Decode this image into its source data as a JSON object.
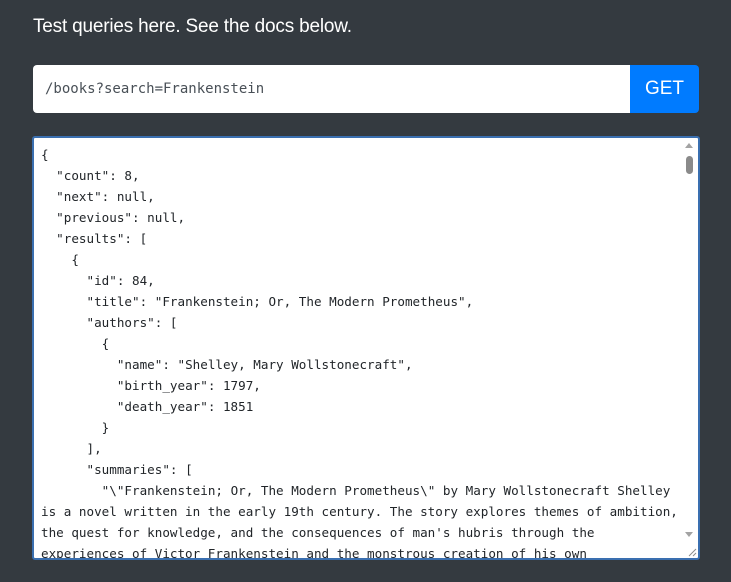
{
  "intro": {
    "text": "Test queries here. See the docs below."
  },
  "query": {
    "value": "/books?search=Frankenstein",
    "button_label": "GET"
  },
  "output": {
    "text": "{\n  \"count\": 8,\n  \"next\": null,\n  \"previous\": null,\n  \"results\": [\n    {\n      \"id\": 84,\n      \"title\": \"Frankenstein; Or, The Modern Prometheus\",\n      \"authors\": [\n        {\n          \"name\": \"Shelley, Mary Wollstonecraft\",\n          \"birth_year\": 1797,\n          \"death_year\": 1851\n        }\n      ],\n      \"summaries\": [\n        \"\\\"Frankenstein; Or, The Modern Prometheus\\\" by Mary Wollstonecraft Shelley is a novel written in the early 19th century. The story explores themes of ambition, the quest for knowledge, and the consequences of man's hubris through the experiences of Victor Frankenstein and the monstrous creation of his own"
  },
  "scrollbar": {
    "up_icon": "scroll-up-arrow-icon",
    "down_icon": "scroll-down-arrow-icon",
    "resize_icon": "resize-grip-icon"
  },
  "colors": {
    "background": "#343a40",
    "button": "#007bff",
    "focus_border": "#3a6fb0"
  }
}
